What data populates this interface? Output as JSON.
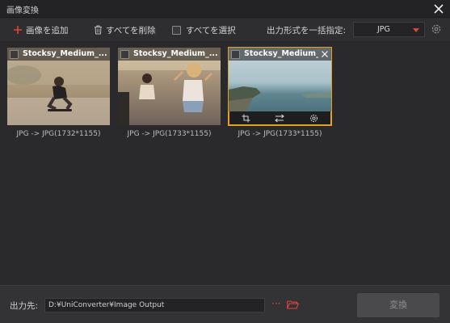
{
  "window": {
    "title": "画像変換"
  },
  "toolbar": {
    "add_label": "画像を追加",
    "delete_all_label": "すべてを削除",
    "select_all_label": "すべてを選択",
    "format_label": "出力形式を一括指定:",
    "format_value": "JPG"
  },
  "images": [
    {
      "name": "Stocksy_Medium_...",
      "info": "JPG -> JPG(1732*1155)"
    },
    {
      "name": "Stocksy_Medium_...",
      "info": "JPG -> JPG(1733*1155)"
    },
    {
      "name": "Stocksy_Medium_...",
      "info": "JPG -> JPG(1733*1155)"
    }
  ],
  "footer": {
    "output_label": "出力先:",
    "output_path": "D:¥UniConverter¥Image Output",
    "more": "···",
    "convert_label": "変換"
  },
  "colors": {
    "accent": "#e0443a",
    "selection": "#e6a21f"
  }
}
